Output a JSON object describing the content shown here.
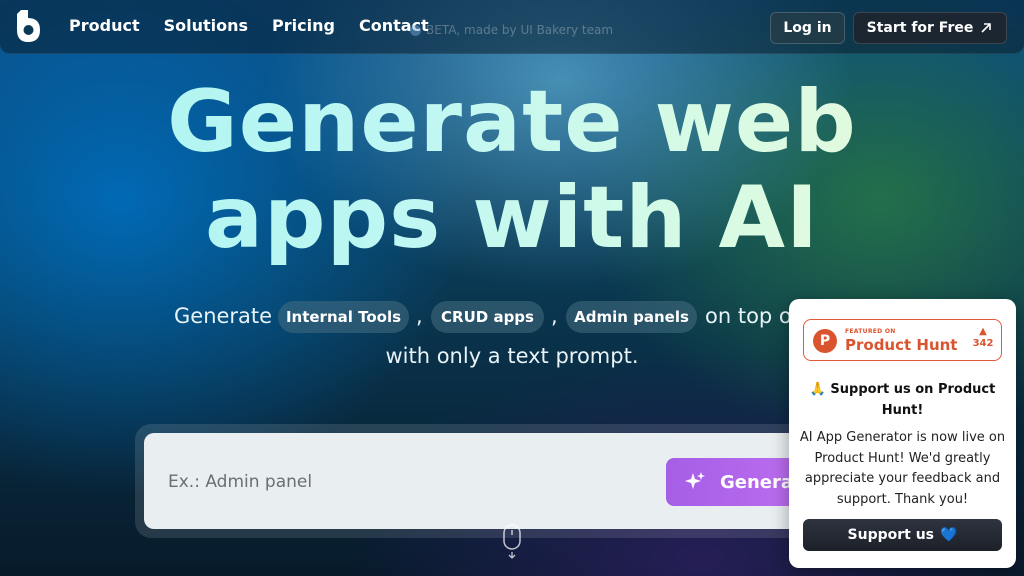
{
  "nav": {
    "links": [
      "Product",
      "Solutions",
      "Pricing",
      "Contact"
    ],
    "beta_text": "BETA, made by UI Bakery team",
    "login_label": "Log in",
    "start_label": "Start for Free",
    "start_icon": "arrow-up-right-icon"
  },
  "hero": {
    "title_line1": "Generate web",
    "title_line2": "apps with AI",
    "sub_prefix": "Generate",
    "chips": [
      "Internal Tools",
      "CRUD apps",
      "Admin panels"
    ],
    "comma": ",",
    "sub_suffix": "on top o",
    "sub_line2": "with only a text prompt."
  },
  "prompt": {
    "placeholder": "Ex.: Admin panel",
    "button_label": "Generat",
    "button_icon": "sparkles-icon"
  },
  "product_hunt": {
    "featured_label": "FEATURED ON",
    "name": "Product Hunt",
    "logo_letter": "P",
    "upvote_arrow": "▲",
    "upvotes": "342",
    "heading_emoji": "🙏",
    "heading": "Support us on Product Hunt!",
    "body": "AI App Generator is now live on Product Hunt! We'd greatly appreciate your feedback and support. Thank you!",
    "button_label": "Support us",
    "button_emoji": "💙"
  },
  "colors": {
    "accent_purple": "#a55ee6",
    "product_hunt_orange": "#da552f",
    "title_gradient_start": "#a9f3f0",
    "title_gradient_end": "#ecf8d8"
  }
}
